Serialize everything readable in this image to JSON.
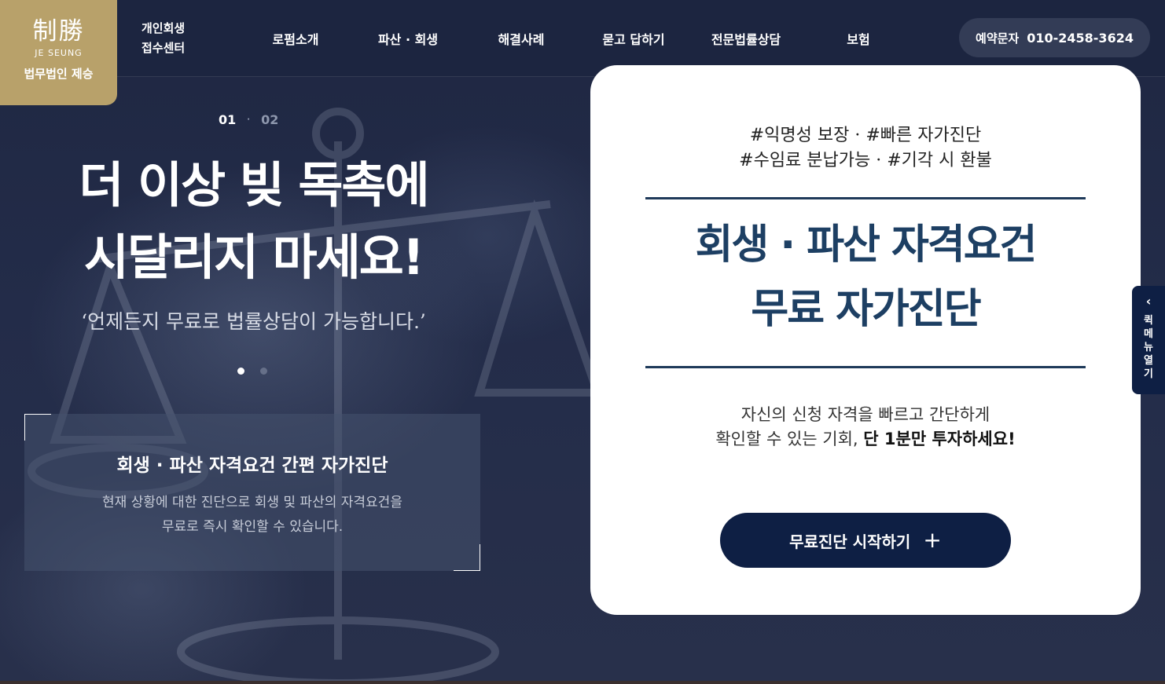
{
  "header": {
    "logo": {
      "hanja": "制勝",
      "en": "JE SEUNG",
      "ko": "법무법인 제승"
    },
    "center_name_line1": "개인회생",
    "center_name_line2": "접수센터",
    "nav": [
      "로펌소개",
      "파산 · 회생",
      "해결사례",
      "묻고 답하기",
      "전문법률상담",
      "보험"
    ],
    "reserve": {
      "label": "예약문자",
      "phone": "010-2458-3624"
    }
  },
  "hero": {
    "slide_current": "01",
    "slide_separator": "·",
    "slide_next": "02",
    "title_line1": "더 이상 빚 독촉에",
    "title_line2": "시달리지 마세요!",
    "subtitle": "‘언제든지 무료로 법률상담이 가능합니다.’",
    "dots_total": 2,
    "dot_active_index": 0,
    "info": {
      "title": "회생 · 파산 자격요건 간편 자가진단",
      "desc_line1": "현재 상황에 대한 진단으로 회생 및 파산의 자격요건을",
      "desc_line2": "무료로 즉시 확인할 수 있습니다."
    }
  },
  "card": {
    "tags_line1": "#익명성 보장 · #빠른 자가진단",
    "tags_line2": "#수임료 분납가능 · #기각 시 환불",
    "title_line1": "회생 · 파산 자격요건",
    "title_line2": "무료 자가진단",
    "desc_line1": "자신의 신청 자격을 빠르고 간단하게",
    "desc_line2_prefix": "확인할 수 있는 기회, ",
    "desc_line2_bold": "단 1분만 투자하세요!",
    "button_label": "무료진단 시작하기",
    "button_icon": "plus-icon"
  },
  "quick_menu": {
    "chevron": "‹",
    "label": "퀵메뉴열기"
  },
  "colors": {
    "logo_gold": "#b8a16a",
    "navy": "#0e1f44",
    "title_blue": "#1d3f63",
    "header_bg": "#1c2540"
  }
}
